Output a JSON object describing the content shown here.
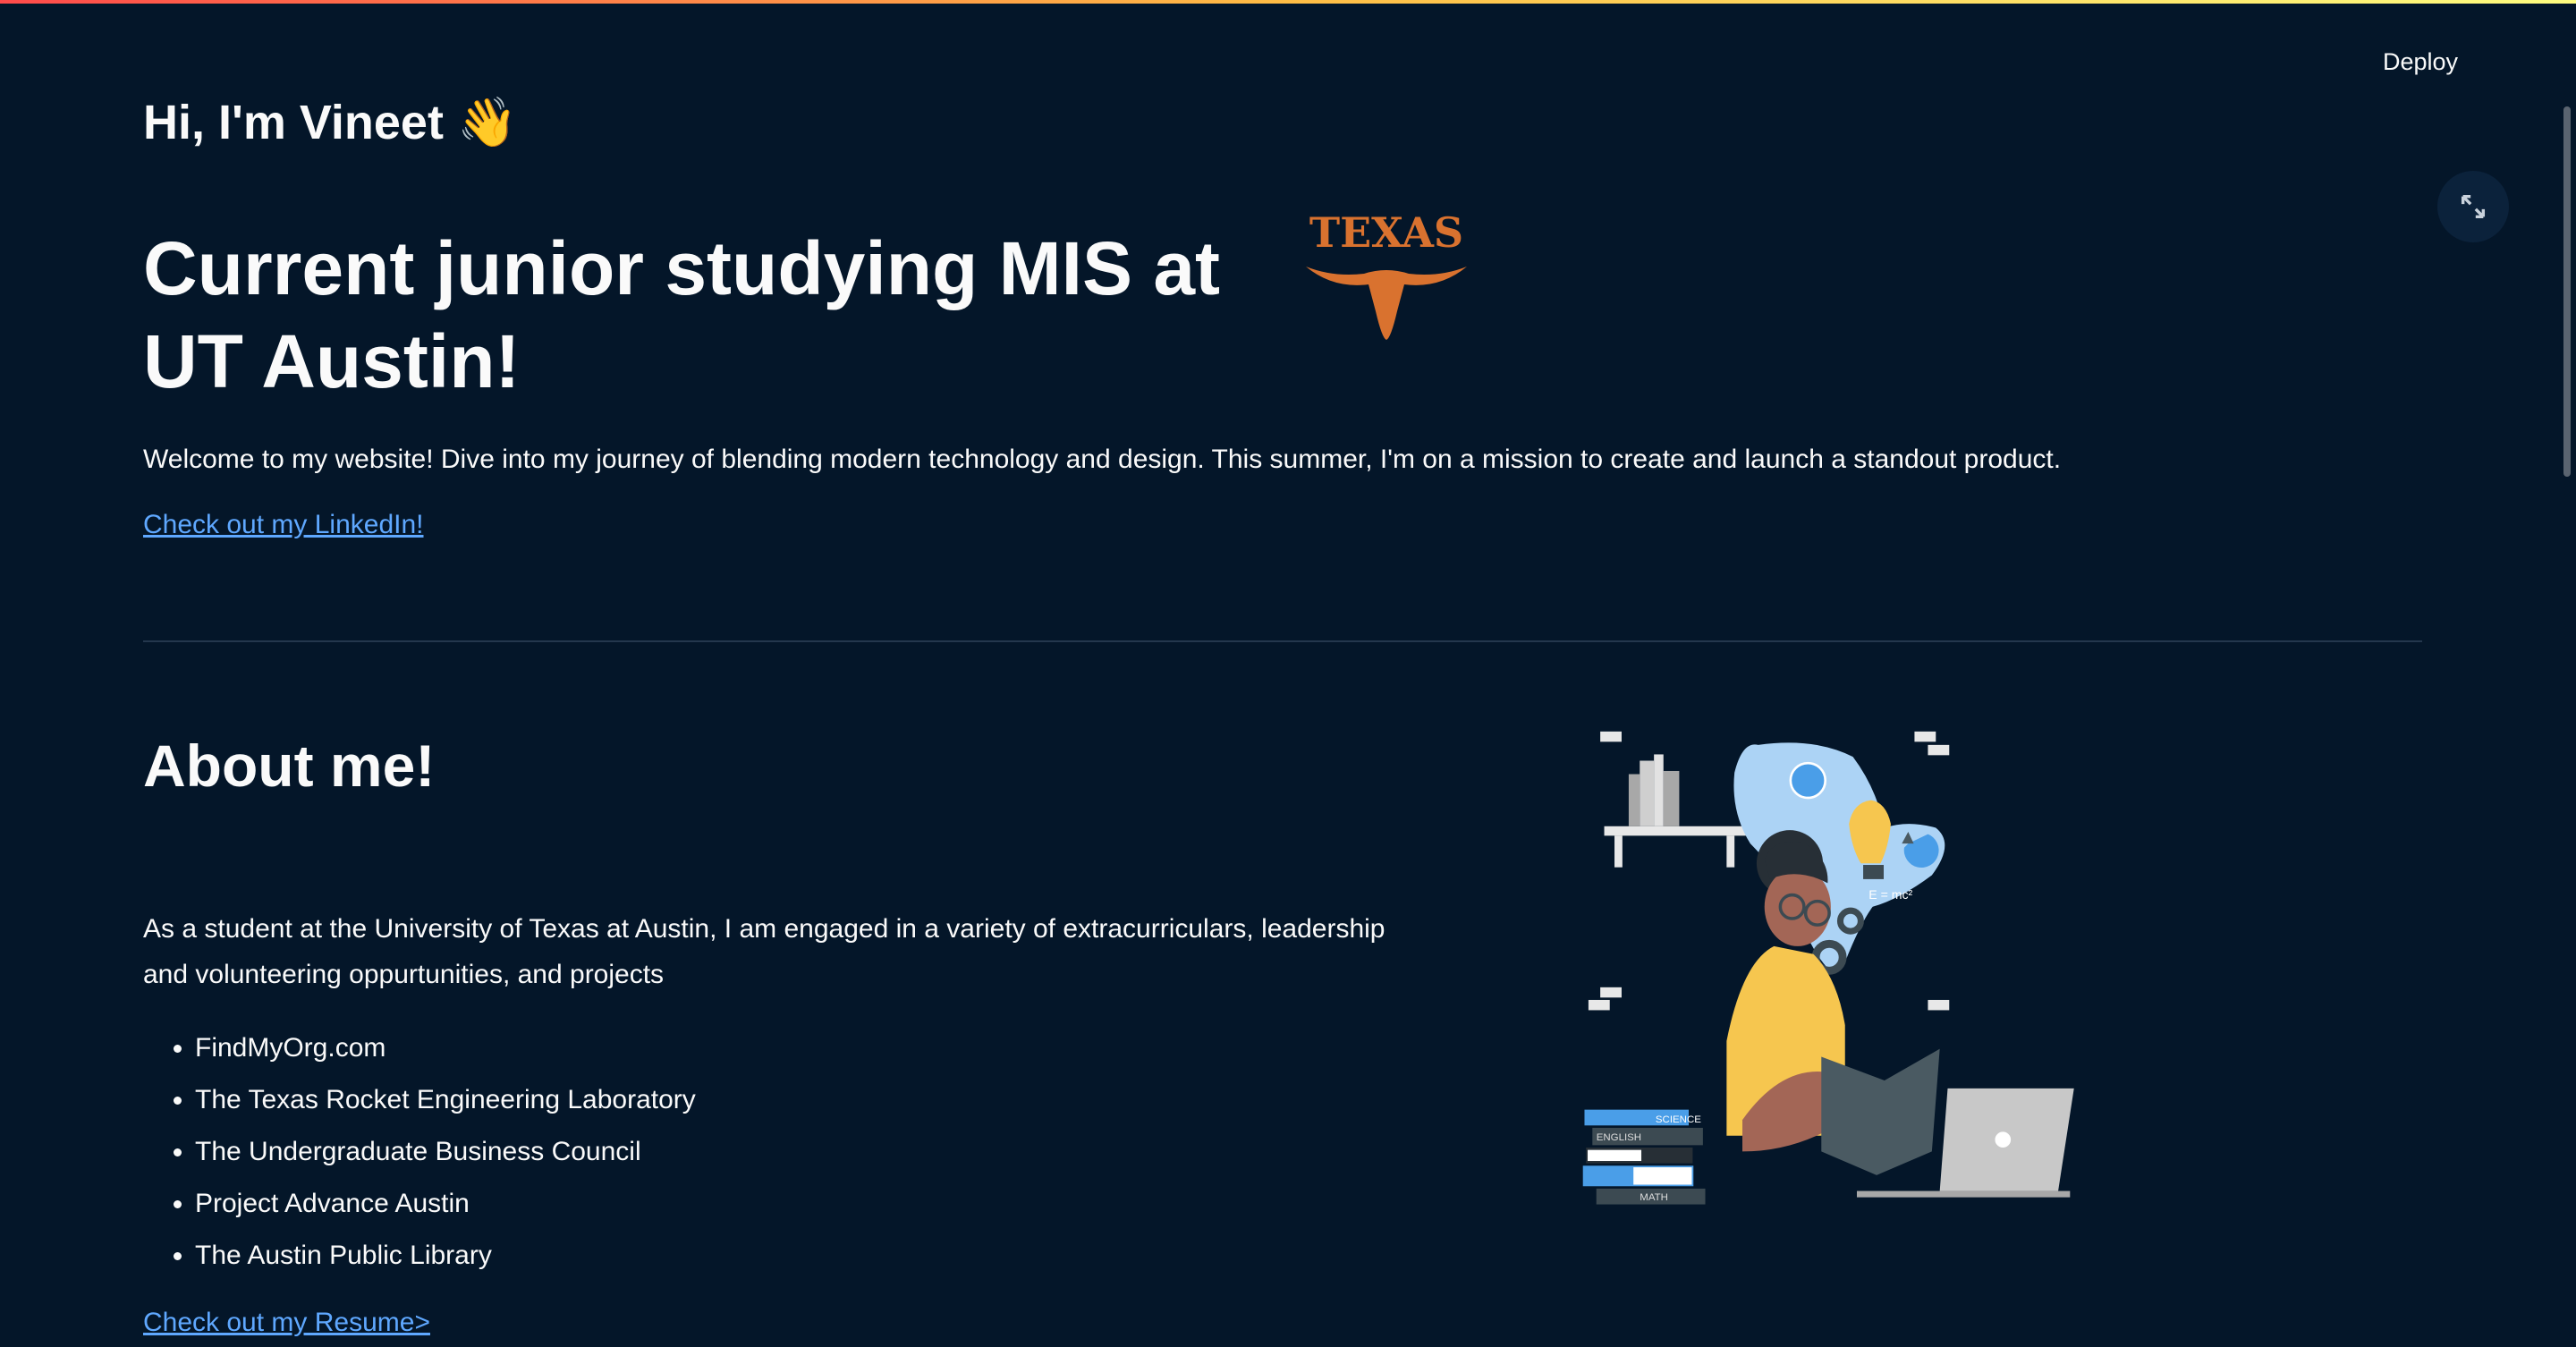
{
  "header": {
    "deploy_label": "Deploy"
  },
  "intro": {
    "greeting": "Hi, I'm Vineet 👋",
    "headline": "Current junior studying MIS at UT Austin!",
    "logo_text": "TEXAS",
    "welcome": "Welcome to my website! Dive into my journey of blending modern technology and design. This summer, I'm on a mission to create and launch a standout product.",
    "linkedin_link": "Check out my LinkedIn!"
  },
  "about": {
    "title": "About me!",
    "description": "As a student at the University of Texas at Austin, I am engaged in a variety of extracurriculars, leadership and volunteering oppurtunities, and projects",
    "items": [
      "FindMyOrg.com",
      "The Texas Rocket Engineering Laboratory",
      "The Undergraduate Business Council",
      "Project Advance Austin",
      "The Austin Public Library"
    ],
    "resume_link": "Check out my Resume>",
    "illustration_labels": [
      "SCIENCE",
      "ENGLISH",
      "MATH",
      "E = mc²"
    ]
  },
  "colors": {
    "background": "#041629",
    "link": "#5fa8ff",
    "texas_orange": "#d9722f"
  }
}
